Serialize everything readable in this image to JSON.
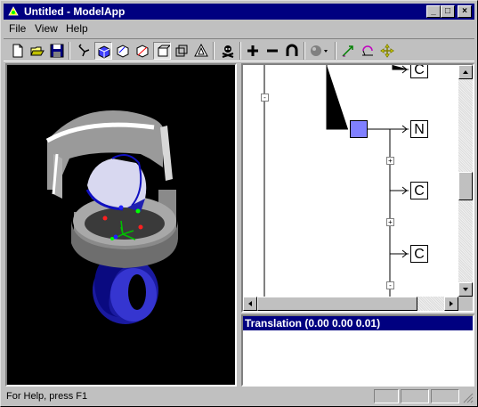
{
  "window": {
    "title": "Untitled - ModelApp"
  },
  "title_buttons": {
    "minimize": "_",
    "maximize": "□",
    "close": "×"
  },
  "menu": {
    "file": "File",
    "view": "View",
    "help": "Help"
  },
  "toolbar": {
    "icons": [
      "new-file-icon",
      "open-folder-icon",
      "save-disk-icon",
      "pointer-tool-icon",
      "shaded-cube-icon",
      "cube-outline-icon",
      "cube-axes-icon",
      "cube-select-icon",
      "cube-wire-icon",
      "triangle-icon",
      "skull-crossbones-icon",
      "plus-icon",
      "minus-icon",
      "arch-icon",
      "sphere-dropdown-icon",
      "scale-arrow-icon",
      "rotate-arc-icon",
      "move-cross-icon"
    ]
  },
  "tree": {
    "nodes": [
      "C",
      "N",
      "C",
      "C"
    ],
    "colors": {
      "selected_node": "#8080ff"
    }
  },
  "info_panel": {
    "header": "Translation  (0.00 0.00 0.01)"
  },
  "status_bar": {
    "text": "For Help, press F1"
  }
}
